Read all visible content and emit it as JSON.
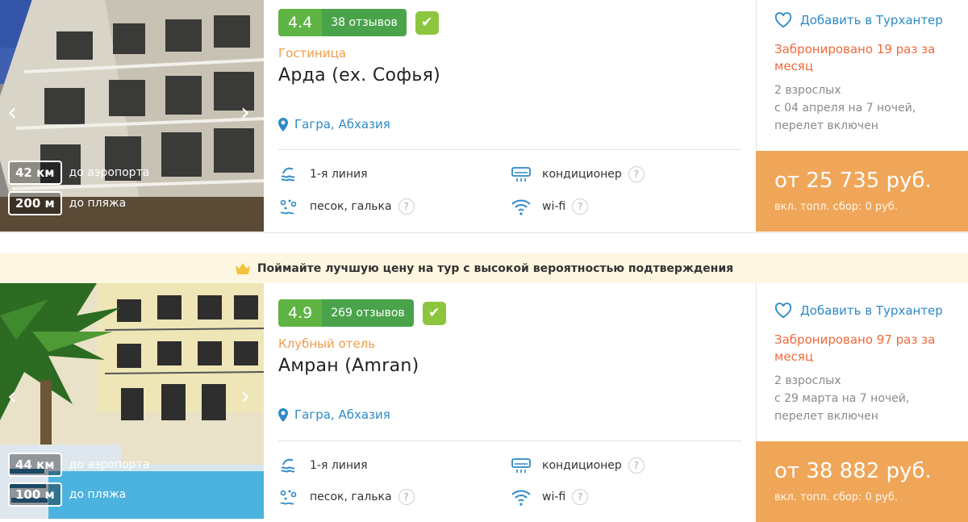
{
  "hotels": [
    {
      "rating": "4.4",
      "reviews": "38 отзывов",
      "type": "Гостиница",
      "name": "Арда (ех. Софья)",
      "location": "Гагра, Абхазия",
      "airport_distance": "42 км",
      "airport_label": "до аэропорта",
      "beach_distance": "200 м",
      "beach_label": "до пляжа",
      "features": {
        "line": "1-я линия",
        "beach_type": "песок, галька",
        "ac": "кондиционер",
        "wifi": "wi-fi"
      },
      "favorite_label": "Добавить в Турхантер",
      "booked": "Забронировано 19 раз за месяц",
      "guests": "2 взрослых",
      "dates": "с 04 апреля на 7 ночей,",
      "flight": "перелет включен",
      "price": "от 25 735 руб.",
      "fee": "вкл. топл. сбор: 0 руб."
    },
    {
      "rating": "4.9",
      "reviews": "269 отзывов",
      "type": "Клубный отель",
      "name": "Амран (Amran)",
      "location": "Гагра, Абхазия",
      "airport_distance": "44 км",
      "airport_label": "до аэропорта",
      "beach_distance": "100 м",
      "beach_label": "до пляжа",
      "features": {
        "line": "1-я линия",
        "beach_type": "песок, галька",
        "ac": "кондиционер",
        "wifi": "wi-fi"
      },
      "favorite_label": "Добавить в Турхантер",
      "booked": "Забронировано 97 раз за месяц",
      "guests": "2 взрослых",
      "dates": "с 29 марта на 7 ночей,",
      "flight": "перелет включен",
      "price": "от 38 882 руб.",
      "fee": "вкл. топл. сбор: 0 руб."
    }
  ],
  "banner": "Поймайте лучшую цену на тур с высокой вероятностью подтверждения",
  "colors": {
    "accent_blue": "#2d8ac7",
    "rating_green": "#5fb444",
    "price_orange": "#f0a659",
    "booked_red": "#ef6a3a",
    "type_orange": "#f09c4a"
  },
  "icons": [
    "chevron-left-icon",
    "chevron-right-icon",
    "location-pin-icon",
    "wave-icon",
    "pebbles-icon",
    "air-conditioner-icon",
    "wifi-icon",
    "help-icon",
    "heart-icon",
    "check-icon",
    "crown-icon"
  ]
}
